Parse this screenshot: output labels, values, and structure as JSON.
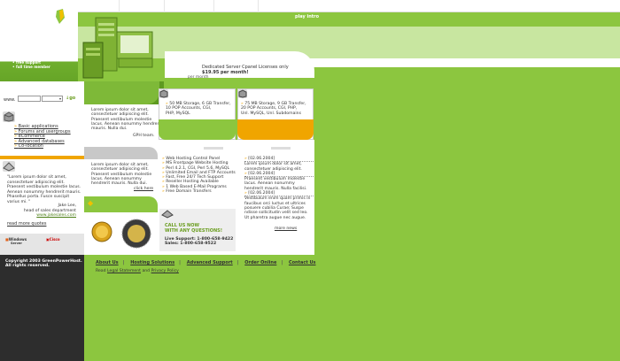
{
  "header": {
    "play_intro": "play intro",
    "bullets": [
      "free sales",
      "free support",
      "full time member"
    ],
    "promo_line1": "Dedicated Server Cpanel Licenses only",
    "promo_line2": "$19.95 per month!",
    "per_month": "per month"
  },
  "search": {
    "label": "www.",
    "input_value": "",
    "select_value": "",
    "go_label": "go"
  },
  "sidebar": {
    "links": [
      "Basic applications",
      "Forums and usergroups",
      "eCommerce",
      "Advanced databases",
      "Co-location"
    ],
    "quote": "\"Lorem ipsum dolor sit amet, consectetuer adipiscing elit. Praesent vestibulum molestie lacus. Aenean nonummy hendrerit mauris. Phasellus porta. Fusce suscipit varius mi. \"",
    "quote_author_name": "Jake Lee,",
    "quote_author_title": "head of sales department",
    "quote_author_site": "www.jakesales.com",
    "read_more_quotes": "read more quotes",
    "partner1": "Windows",
    "partner1_sub": "Server",
    "partner2": "Cisco"
  },
  "middle": {
    "lorem1": "Lorem ipsum dolor sit amet, consectetuer adipiscing elit. Praesent vestibulum molestie lacus. Aenean nonummy hendrerit mauris. Nulla dui.",
    "team": "GPH team.",
    "lorem2": "Lorem ipsum dolor sit amet, consectetuer adipiscing elit. Praesent vestibulum molestie lacus. Aenean nonummy hendrerit mauris. Nulla dui.",
    "click_here": "click here"
  },
  "plans": [
    {
      "line1": "50 MB Storage, 6 GB Transfer,",
      "line2": "10 POP Accounts, CGI,",
      "line3": "PHP, MySQL"
    },
    {
      "line1": "75 MB Storage, 9 GB Transfer,",
      "line2": "20 POP Accounts, CGI, PHP,",
      "line3": "Unl. MySQL, Unl. Subdomains"
    }
  ],
  "features": [
    "Web Hosting Control Panel",
    "MS Frontpage Website Hosting",
    "Perl 4.2.1, CGI, Perl 5.6, MySQL",
    "Unlimited Email and FTP Accounts",
    "Fast, Free 24/7 Tech Support",
    "Reseller Hosting Available",
    "1 Web Based E-Mail Programs",
    "Free Domain Transfers"
  ],
  "news": [
    {
      "date": "[02.06.2004]",
      "text": "Lorem ipsum dolor sit amet, consectetuer adipiscing elit."
    },
    {
      "date": "[02.06.2004]",
      "text": "Praesent vestibulum molestie lacus. Aenean nonummy hendrerit mauris. Nulla facilisi."
    },
    {
      "date": "[02.06.2004]",
      "text": "Vestibulum enim quam primis in faucibus orci luctus et ultrices posuere cubilia Curae; Suspe ndisse sollicitudin velit sed leo. Ut pharetra augue nec augue."
    }
  ],
  "more_news": "more news",
  "call": {
    "line1": "CALL US NOW",
    "line2": "WITH ANY QUESTIONS!",
    "support": "Live Support: 1-800-658-9422",
    "sales": "Sales: 1-800-658-9522"
  },
  "footer": {
    "copyright_line1": "Copyright 2003 GreenPowerHost.",
    "copyright_line2": "All rights reserved.",
    "nav": [
      "About Us",
      "Hosting Solutions",
      "Advanced Support",
      "Order Online",
      "Contact Us"
    ],
    "note_prefix": "Read",
    "legal": "Legal Statement",
    "and": "and",
    "privacy": "Privacy Policy"
  },
  "colors": {
    "brand_green": "#8cc63f",
    "accent_orange": "#f0a500",
    "dark": "#2d2d2d"
  }
}
